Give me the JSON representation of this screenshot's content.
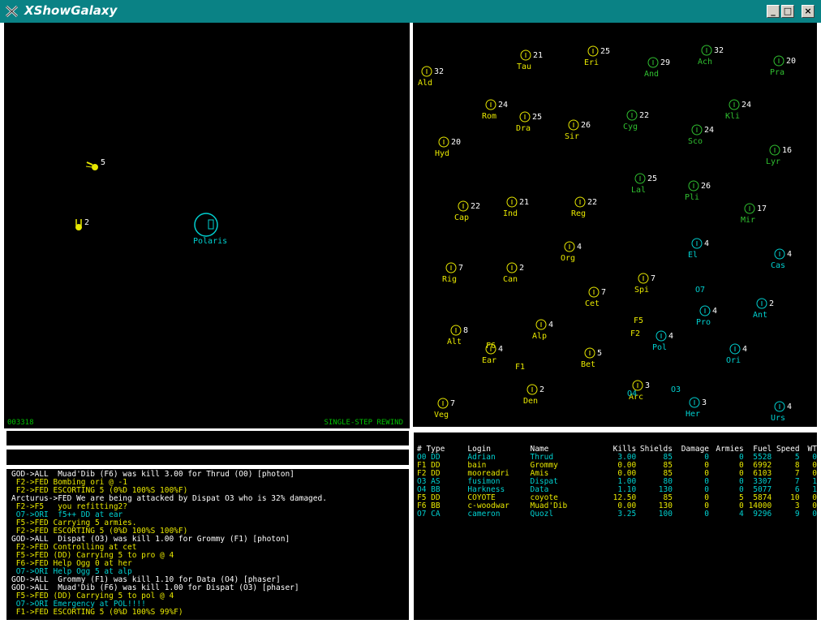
{
  "window": {
    "title": "XShowGalaxy",
    "buttons": {
      "minimize": "_",
      "maximize": "□",
      "close": "×"
    }
  },
  "colors": {
    "yellow": "#e8e800",
    "green": "#30c030",
    "cyan": "#00d0d0",
    "white": "#ffffff",
    "status": "#00c000"
  },
  "tactical": {
    "status_left": "003318",
    "status_right": "SINGLE-STEP REWIND",
    "planet": {
      "name": "Polaris",
      "color": "cyan"
    },
    "ships": [
      {
        "label": "5",
        "color": "yellow"
      },
      {
        "label": "2",
        "color": "yellow"
      }
    ]
  },
  "galaxy": {
    "planets": [
      {
        "abbr": "Ald",
        "armies": "32",
        "color": "yellow"
      },
      {
        "abbr": "Tau",
        "armies": "21",
        "color": "yellow"
      },
      {
        "abbr": "Eri",
        "armies": "25",
        "color": "yellow"
      },
      {
        "abbr": "And",
        "armies": "29",
        "color": "green"
      },
      {
        "abbr": "Ach",
        "armies": "32",
        "color": "green"
      },
      {
        "abbr": "Pra",
        "armies": "20",
        "color": "green"
      },
      {
        "abbr": "Rom",
        "armies": "24",
        "color": "yellow"
      },
      {
        "abbr": "Dra",
        "armies": "25",
        "color": "yellow"
      },
      {
        "abbr": "Sir",
        "armies": "26",
        "color": "yellow"
      },
      {
        "abbr": "Cyg",
        "armies": "22",
        "color": "green"
      },
      {
        "abbr": "Kli",
        "armies": "24",
        "color": "green"
      },
      {
        "abbr": "Sco",
        "armies": "24",
        "color": "green"
      },
      {
        "abbr": "Hyd",
        "armies": "20",
        "color": "yellow"
      },
      {
        "abbr": "Lyr",
        "armies": "16",
        "color": "green"
      },
      {
        "abbr": "Lal",
        "armies": "25",
        "color": "green"
      },
      {
        "abbr": "Pli",
        "armies": "26",
        "color": "green"
      },
      {
        "abbr": "Cap",
        "armies": "22",
        "color": "yellow"
      },
      {
        "abbr": "Ind",
        "armies": "21",
        "color": "yellow"
      },
      {
        "abbr": "Reg",
        "armies": "22",
        "color": "yellow"
      },
      {
        "abbr": "Mir",
        "armies": "17",
        "color": "green"
      },
      {
        "abbr": "Org",
        "armies": "4",
        "color": "yellow"
      },
      {
        "abbr": "El",
        "armies": "4",
        "color": "cyan"
      },
      {
        "abbr": "Cas",
        "armies": "4",
        "color": "cyan"
      },
      {
        "abbr": "Rig",
        "armies": "7",
        "color": "yellow"
      },
      {
        "abbr": "Can",
        "armies": "2",
        "color": "yellow"
      },
      {
        "abbr": "Spi",
        "armies": "7",
        "color": "yellow"
      },
      {
        "abbr": "Cet",
        "armies": "7",
        "color": "yellow"
      },
      {
        "abbr": "Pro",
        "armies": "4",
        "color": "cyan"
      },
      {
        "abbr": "Ant",
        "armies": "2",
        "color": "cyan"
      },
      {
        "abbr": "Alt",
        "armies": "8",
        "color": "yellow"
      },
      {
        "abbr": "Alp",
        "armies": "4",
        "color": "yellow"
      },
      {
        "abbr": "Pol",
        "armies": "4",
        "color": "cyan"
      },
      {
        "abbr": "Ear",
        "armies": "4",
        "color": "yellow"
      },
      {
        "abbr": "Bet",
        "armies": "5",
        "color": "yellow"
      },
      {
        "abbr": "Ori",
        "armies": "4",
        "color": "cyan"
      },
      {
        "abbr": "Den",
        "armies": "2",
        "color": "yellow"
      },
      {
        "abbr": "Arc",
        "armies": "3",
        "color": "yellow"
      },
      {
        "abbr": "Her",
        "armies": "3",
        "color": "cyan"
      },
      {
        "abbr": "Veg",
        "armies": "7",
        "color": "yellow"
      },
      {
        "abbr": "Urs",
        "armies": "4",
        "color": "cyan"
      }
    ],
    "ship_labels": [
      {
        "text": "O7",
        "color": "cyan"
      },
      {
        "text": "F5",
        "color": "yellow"
      },
      {
        "text": "F2",
        "color": "yellow"
      },
      {
        "text": "F6",
        "color": "yellow"
      },
      {
        "text": "F1",
        "color": "yellow"
      },
      {
        "text": "O4",
        "color": "cyan"
      },
      {
        "text": "O3",
        "color": "cyan"
      }
    ]
  },
  "messages": [
    {
      "text": "GOD->ALL  Muad'Dib (F6) was kill 3.00 for Thrud (O0) [photon]",
      "color": "white"
    },
    {
      "text": " F2->FED Bombing ori @ -1",
      "color": "yellow"
    },
    {
      "text": " F2->FED ESCORTING 5 (0%D 100%S 100%F)",
      "color": "yellow"
    },
    {
      "text": "Arcturus->FED We are being attacked by Dispat O3 who is 32% damaged.",
      "color": "white"
    },
    {
      "text": " F2->F5   you refitting2?",
      "color": "yellow"
    },
    {
      "text": " O7->ORI  f5++ DD at ear",
      "color": "cyan"
    },
    {
      "text": " F5->FED Carrying 5 armies.",
      "color": "yellow"
    },
    {
      "text": " F2->FED ESCORTING 5 (0%D 100%S 100%F)",
      "color": "yellow"
    },
    {
      "text": "GOD->ALL  Dispat (O3) was kill 1.00 for Grommy (F1) [photon]",
      "color": "white"
    },
    {
      "text": " F2->FED Controlling at cet",
      "color": "yellow"
    },
    {
      "text": " F5->FED (DD) Carrying 5 to pro @ 4",
      "color": "yellow"
    },
    {
      "text": " F6->FED Help Ogg 0 at her",
      "color": "yellow"
    },
    {
      "text": " O7->ORI Help Ogg 5 at alp",
      "color": "cyan"
    },
    {
      "text": "GOD->ALL  Grommy (F1) was kill 1.10 for Data (O4) [phaser]",
      "color": "white"
    },
    {
      "text": "GOD->ALL  Muad'Dib (F6) was kill 1.00 for Dispat (O3) [phaser]",
      "color": "white"
    },
    {
      "text": " F5->FED (DD) Carrying 5 to pol @ 4",
      "color": "yellow"
    },
    {
      "text": " O7->ORI Emergency at POL!!!!",
      "color": "cyan"
    },
    {
      "text": " F1->FED ESCORTING 5 (0%D 100%S 99%F)",
      "color": "yellow"
    }
  ],
  "players": {
    "headers": [
      "# Type",
      "Login",
      "Name",
      "Kills",
      "Shields",
      "Damage",
      "Armies",
      "Fuel",
      "Speed",
      "WT"
    ],
    "rows": [
      {
        "cells": [
          "O0 DD",
          "Adrian",
          "Thrud",
          "3.00",
          "85",
          "0",
          "0",
          "5528",
          "5",
          "0"
        ],
        "color": "cyan"
      },
      {
        "cells": [
          "F1 DD",
          "bain",
          "Grommy",
          "0.00",
          "85",
          "0",
          "0",
          "6992",
          "8",
          "0"
        ],
        "color": "yellow"
      },
      {
        "cells": [
          "F2 DD",
          "mooreadri",
          "Amis",
          "0.00",
          "85",
          "0",
          "0",
          "6103",
          "7",
          "0"
        ],
        "color": "yellow"
      },
      {
        "cells": [
          "O3 AS",
          "fusimon",
          "Dispat",
          "1.00",
          "80",
          "0",
          "0",
          "3307",
          "7",
          "1"
        ],
        "color": "cyan"
      },
      {
        "cells": [
          "O4 BB",
          "Harkness",
          "Data",
          "1.10",
          "130",
          "0",
          "0",
          "5077",
          "6",
          "1"
        ],
        "color": "cyan"
      },
      {
        "cells": [
          "F5 DD",
          "COYOTE",
          "coyote",
          "12.50",
          "85",
          "0",
          "5",
          "5874",
          "10",
          "0"
        ],
        "color": "yellow"
      },
      {
        "cells": [
          "F6 BB",
          "c-woodwar",
          "Muad'Dib",
          "0.00",
          "130",
          "0",
          "0",
          "14000",
          "3",
          "0"
        ],
        "color": "yellow"
      },
      {
        "cells": [
          "O7 CA",
          "cameron",
          "Quozl",
          "3.25",
          "100",
          "0",
          "4",
          "9296",
          "9",
          "0"
        ],
        "color": "cyan"
      }
    ]
  }
}
